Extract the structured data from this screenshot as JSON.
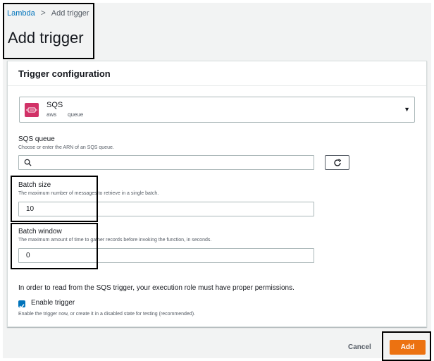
{
  "breadcrumb": {
    "root": "Lambda",
    "current": "Add trigger"
  },
  "page_title": "Add trigger",
  "panel": {
    "title": "Trigger configuration",
    "source": {
      "name": "SQS",
      "tag1": "aws",
      "tag2": "queue"
    },
    "queue": {
      "label": "SQS queue",
      "description": "Choose or enter the ARN of an SQS queue.",
      "value": ""
    },
    "batch_size": {
      "label": "Batch size",
      "description": "The maximum number of messages to retrieve in a single batch.",
      "value": "10"
    },
    "batch_window": {
      "label": "Batch window",
      "description": "The maximum amount of time to gather records before invoking the function, in seconds.",
      "value": "0"
    },
    "permissions_note": "In order to read from the SQS trigger, your execution role must have proper permissions.",
    "enable": {
      "label": "Enable trigger",
      "description": "Enable the trigger now, or create it in a disabled state for testing (recommended).",
      "checked": true
    }
  },
  "footer": {
    "cancel_label": "Cancel",
    "add_label": "Add"
  },
  "colors": {
    "accent": "#ec7211",
    "link": "#0073bb",
    "sqs": "#d13267"
  }
}
